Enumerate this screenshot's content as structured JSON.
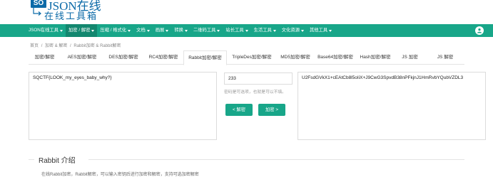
{
  "logo": {
    "badge": "SO",
    "brand": "JSON",
    "brand_suffix": "在线",
    "subtitle": "在线工具箱"
  },
  "nav": {
    "items": [
      {
        "label": "JSON在线工具",
        "caret": true
      },
      {
        "label": "加密 / 解密",
        "caret": true,
        "active": true
      },
      {
        "label": "压缩 / 格式化",
        "caret": true
      },
      {
        "label": "文档",
        "caret": true
      },
      {
        "label": "画展",
        "caret": true
      },
      {
        "label": "转换",
        "caret": true
      },
      {
        "label": "二维码工具",
        "caret": true
      },
      {
        "label": "站长工具",
        "caret": true
      },
      {
        "label": "生活工具",
        "caret": true
      },
      {
        "label": "文化资源",
        "caret": true
      },
      {
        "label": "其他工具",
        "caret": true
      }
    ]
  },
  "breadcrumb": {
    "home": "首页",
    "sep1": "/",
    "section": "加密 & 解密",
    "sep2": "/",
    "current": "Rabbit加密 & Rabbit解密"
  },
  "tabs": [
    {
      "label": "加密/解密"
    },
    {
      "label": "AES加密/解密"
    },
    {
      "label": "DES加密/解密"
    },
    {
      "label": "RC4加密/解密"
    },
    {
      "label": "Rabbit加密/解密",
      "active": true
    },
    {
      "label": "TripleDes加密/解密"
    },
    {
      "label": "MD5加密/解密"
    },
    {
      "label": "Base64加密/解密"
    },
    {
      "label": "Hash加密/解密"
    },
    {
      "label": "JS 加密"
    },
    {
      "label": "JS 解密"
    }
  ],
  "input": {
    "value": "SQCTF{LOOK_my_eyes_baby_why?}"
  },
  "key": {
    "value": "233",
    "hint": "密码是可选项，也就是可以不填。"
  },
  "buttons": {
    "decrypt": "< 解密",
    "encrypt": "加密 >"
  },
  "output": {
    "value": "U2FsdGVkX1+cEAtCb8l5oIiX+J9CwG3SpvdB38nPFkjnJ1HmRvbYQubVZDL3"
  },
  "section": {
    "title": "Rabbit 介绍",
    "text": "在线Rabbit加密，Rabbit解密，可以输入密钥后进行加密和解密，支持可选加密解密"
  },
  "colors": {
    "accent": "#18a689",
    "accent_dark": "#13876f",
    "brand_blue": "#0b6aa8"
  },
  "icons": {
    "user": "user-avatar-icon",
    "arrow": "return-arrow-icon"
  }
}
